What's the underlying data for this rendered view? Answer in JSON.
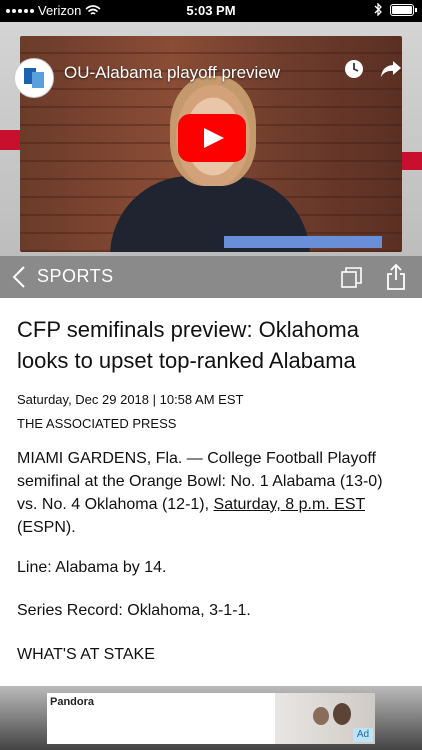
{
  "status_bar": {
    "carrier": "Verizon",
    "time": "5:03 PM"
  },
  "video": {
    "title": "OU-Alabama playoff preview"
  },
  "nav": {
    "section": "SPORTS"
  },
  "article": {
    "headline": "CFP semifinals preview: Oklahoma looks to upset top-ranked Alabama",
    "dateline": "Saturday, Dec 29 2018 | 10:58 AM EST",
    "source": "THE ASSOCIATED PRESS",
    "para1_text": "MIAMI GARDENS, Fla. — College Football Playoff semifinal at the Orange Bowl: No. 1 Alabama (13-0) vs. No. 4 Oklahoma (12-1), ",
    "para1_link": "Saturday, 8 p.m. EST",
    "para1_tail": " (ESPN).",
    "para2": "Line: Alabama by 14.",
    "para3": "Series Record: Oklahoma, 3-1-1.",
    "para4": "WHAT'S AT STAKE"
  },
  "ad": {
    "brand": "Pandora",
    "badge": "Ad"
  },
  "colors": {
    "youtube_red": "#ff0000",
    "nav_gray": "#8a8a8a",
    "accent_red": "#c8102e"
  }
}
